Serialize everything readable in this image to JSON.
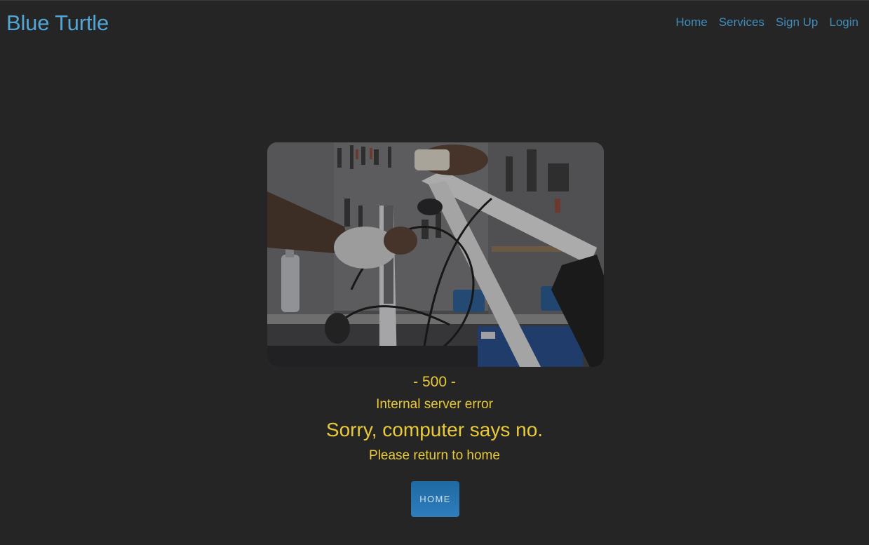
{
  "header": {
    "brand": "Blue Turtle",
    "nav": [
      {
        "label": "Home"
      },
      {
        "label": "Services"
      },
      {
        "label": "Sign Up"
      },
      {
        "label": "Login"
      }
    ]
  },
  "error": {
    "code": "- 500 -",
    "title": "Internal server error",
    "headline": "Sorry, computer says no.",
    "message": "Please return to home",
    "button_label": "HOME"
  },
  "colors": {
    "background": "#252525",
    "brand": "#52a6d6",
    "nav_link": "#3f8cbc",
    "error_text": "#e8c93a",
    "button": "#2a75b3"
  }
}
